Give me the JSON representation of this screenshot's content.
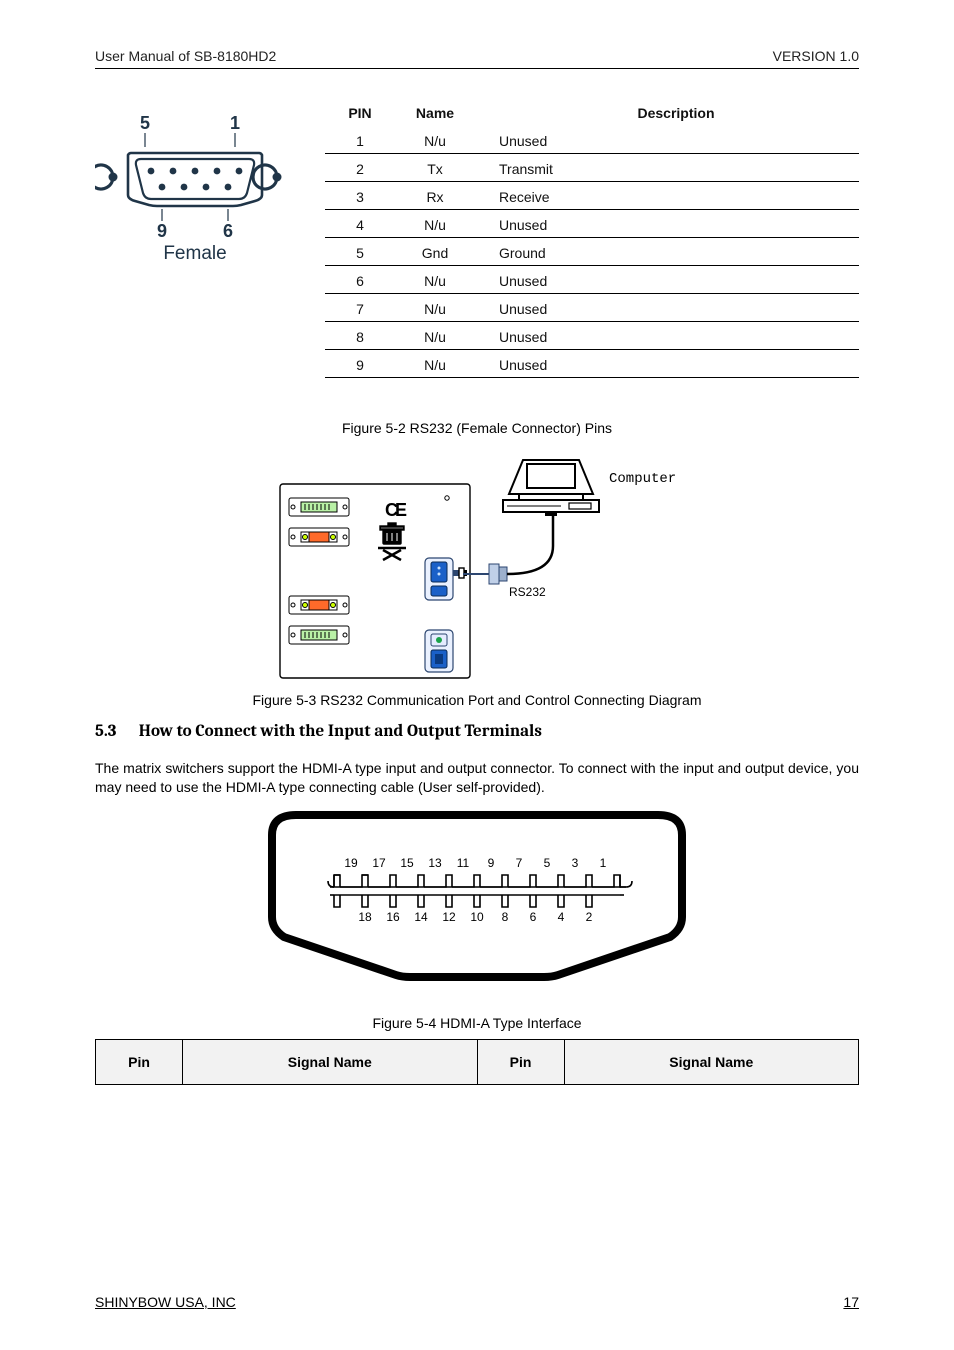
{
  "header": {
    "left": "User Manual of SB-8180HD2",
    "right": "VERSION 1.0"
  },
  "db9": {
    "label_top_left": "5",
    "label_top_right": "1",
    "label_bot_left": "9",
    "label_bot_right": "6",
    "label_female": "Female"
  },
  "pin_table": {
    "headers": [
      "PIN",
      "Name",
      "Description"
    ],
    "rows": [
      [
        "1",
        "N/u",
        "Unused"
      ],
      [
        "2",
        "Tx",
        "Transmit"
      ],
      [
        "3",
        "Rx",
        "Receive"
      ],
      [
        "4",
        "N/u",
        "Unused"
      ],
      [
        "5",
        "Gnd",
        "Ground"
      ],
      [
        "6",
        "N/u",
        "Unused"
      ],
      [
        "7",
        "N/u",
        "Unused"
      ],
      [
        "8",
        "N/u",
        "Unused"
      ],
      [
        "9",
        "N/u",
        "Unused"
      ]
    ]
  },
  "captions": {
    "rs232_pins": "Figure 5-2 RS232 (Female Connector) Pins",
    "rs232_diagram": "Figure 5-3 RS232 Communication Port and Control Connecting Diagram",
    "hdmi_interface": "Figure 5-4 HDMI-A Type Interface"
  },
  "rs232_diagram": {
    "label_computer": "Computer",
    "label_rs232": "RS232"
  },
  "section": {
    "num": "5.3",
    "title": "How to Connect with the Input and Output Terminals"
  },
  "paragraph": "The matrix switchers support the HDMI-A type input and output connector. To connect with the input and output device, you may need to use the HDMI-A type connecting cable (User self-provided).",
  "hdmi_pins": [
    "19",
    "17",
    "15",
    "13",
    "11",
    "9",
    "7",
    "5",
    "3",
    "1",
    "18",
    "16",
    "14",
    "12",
    "10",
    "8",
    "6",
    "4",
    "2"
  ],
  "bottom_table": {
    "headers": [
      "Pin",
      "Signal Name",
      "Pin",
      "Signal Name"
    ]
  },
  "footer": {
    "left": "SHINYBOW USA, INC",
    "right": "17"
  }
}
